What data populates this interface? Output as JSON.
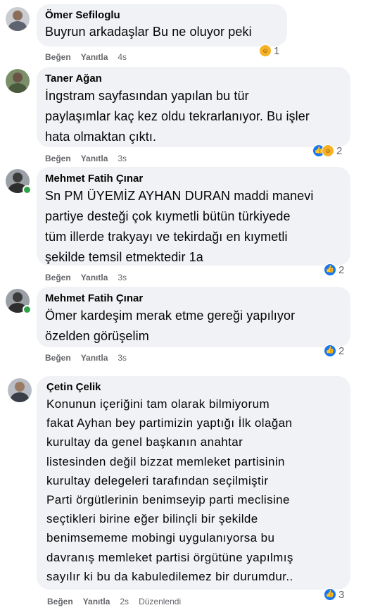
{
  "colors": {
    "bubble": "#f0f2f5",
    "meta": "#65676b",
    "like": "#1877f2",
    "haha": "#f7b125",
    "online": "#31a24c"
  },
  "comments": [
    {
      "author": "Ömer Sefiloglu",
      "lines": [
        "Buyrun arkadaşlar Bu ne oluyor peki"
      ],
      "like_label": "Beğen",
      "reply_label": "Yanıtla",
      "time": "4s",
      "reactions": {
        "icons": [
          "haha-icon"
        ],
        "count": "1"
      }
    },
    {
      "author": "Taner Ağan",
      "lines": [
        "İngstram sayfasından yapılan bu tür",
        "paylaşımlar kaç kez oldu tekrarlanıyor. Bu işler",
        "hata olmaktan çıktı."
      ],
      "like_label": "Beğen",
      "reply_label": "Yanıtla",
      "time": "3s",
      "reactions": {
        "icons": [
          "like-icon",
          "haha-icon"
        ],
        "count": "2"
      }
    },
    {
      "author": "Mehmet Fatih Çınar",
      "lines": [
        "Sn PM ÜYEMİZ AYHAN DURAN maddi manevi",
        "partiye desteği çok kıymetli bütün türkiyede",
        "tüm illerde trakyayı ve tekirdağı en kıymetli",
        "şekilde temsil etmektedir 1a"
      ],
      "like_label": "Beğen",
      "reply_label": "Yanıtla",
      "time": "3s",
      "reactions": {
        "icons": [
          "like-icon"
        ],
        "count": "2"
      }
    },
    {
      "author": "Mehmet Fatih Çınar",
      "lines": [
        "Ömer kardeşim merak etme gereği yapılıyor",
        "özelden görüşelim"
      ],
      "like_label": "Beğen",
      "reply_label": "Yanıtla",
      "time": "3s",
      "reactions": {
        "icons": [
          "like-icon"
        ],
        "count": "2"
      }
    },
    {
      "author": "Çetin Çelik",
      "lines": [
        "Konunun içeriğini tam olarak bilmiyorum",
        "fakat Ayhan bey partimizin yaptığı İlk olağan",
        "kurultay da genel başkanın anahtar",
        "listesinden değil bizzat memleket partisinin",
        "kurultay delegeleri tarafından seçilmiştir",
        "Parti örgütlerinin benimseyip parti meclisine",
        "seçtikleri birine eğer bilinçli bir şekilde",
        "benimsememe mobingi uygulanıyorsa bu",
        "davranış memleket partisi örgütüne yapılmış",
        "sayılır ki bu da kabuledilemez bir durumdur.."
      ],
      "like_label": "Beğen",
      "reply_label": "Yanıtla",
      "time": "2s",
      "edited_label": "Düzenlendi",
      "reactions": {
        "icons": [
          "like-icon"
        ],
        "count": "3"
      }
    }
  ]
}
